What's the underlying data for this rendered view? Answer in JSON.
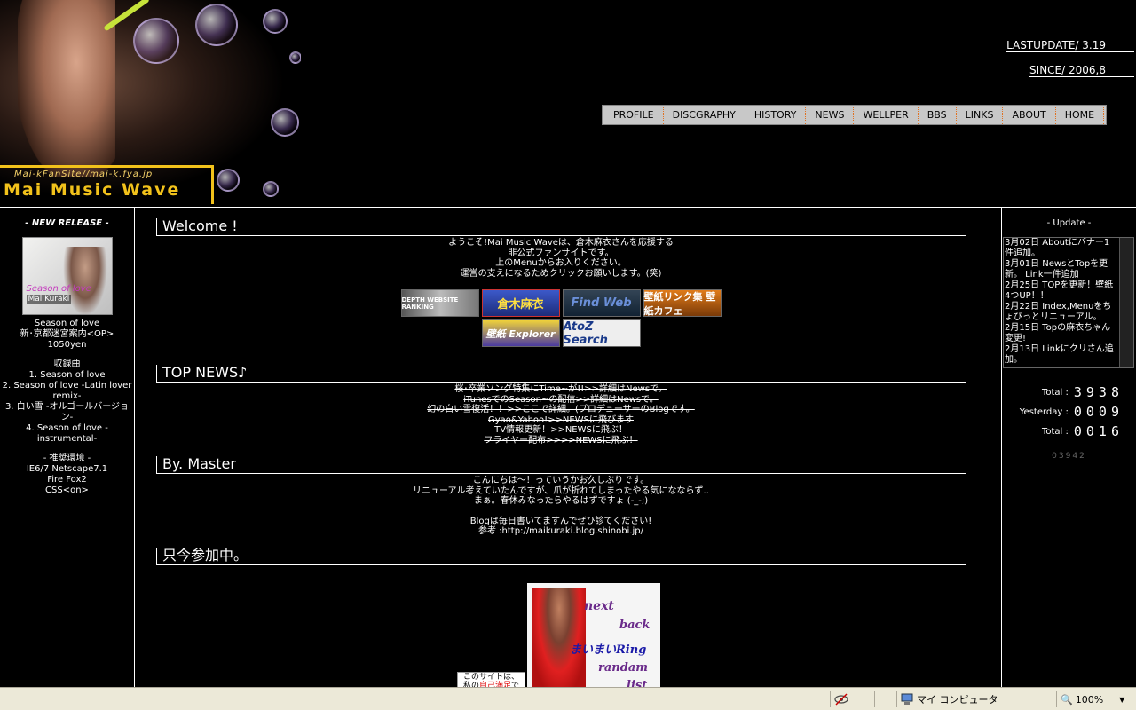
{
  "header": {
    "logo_sub": "Mai-kFanSite//mai-k.fya.jp",
    "logo_title": "Mai Music Wave",
    "lastupdate": "LASTUPDATE/ 3.19",
    "since": "SINCE/ 2006,8"
  },
  "nav": [
    "PROFILE",
    "DISCGRAPHY",
    "HISTORY",
    "NEWS",
    "WELLPER",
    "BBS",
    "LINKS",
    "ABOUT",
    "HOME"
  ],
  "left": {
    "release_head": "- NEW RELEASE -",
    "cover_title": "Season of love",
    "cover_artist": "Mai Kuraki",
    "release_title": "Season of love",
    "release_sub": "新･京都迷宮案内<OP>",
    "price": "1050yen",
    "tracks_head": "収録曲",
    "tracks": [
      "1. Season of love",
      "2. Season of love -Latin lover",
      "remix-",
      "3. 白い雪 -オルゴールバージョン-",
      "4. Season of love -",
      "instrumental-"
    ],
    "env_head": "- 推奨環境 -",
    "env": [
      "IE6/7 Netscape7.1",
      "Fire Fox2",
      "CSS<on>"
    ]
  },
  "main": {
    "welcome_title": "Welcome !",
    "welcome_lines": [
      "ようこそ!Mai Music Waveは、倉木麻衣さんを応援する",
      "非公式ファンサイトです。",
      "上のMenuからお入りください。",
      "運営の支えになるためクリックお願いします。(笑)"
    ],
    "banners": {
      "depth": "DEPTH WEBSITE RANKING",
      "kuraki": "倉木麻衣",
      "findweb": "Find Web",
      "wallcafe": "壁紙リンク集 壁紙カフェ",
      "wallexp": "壁紙 Explorer",
      "atoz": "AtoZ Search"
    },
    "news_title": "TOP NEWS♪",
    "news_lines": [
      "桜･卒業ソング特集にTime~が!!>>詳細はNewsで。",
      "iTunesでのSeason~の配信>>詳細はNewsで。",
      "幻の白い雪復活！！>>ここで詳細。(プロデューサーのBlogです。",
      "Gyao&Yahoo!>>NEWSに飛びます",
      "TV情報更新！>>NEWSに飛ぶ！",
      "フライヤー配布>>>>NEWSに飛ぶ！"
    ],
    "master_title": "By. Master",
    "master_lines": [
      "こんにちは～！っていうかお久しぶりです。",
      "リニューアル考えていたんですが、爪が折れてしまったやる気になならず‥",
      "まぁ。春休みなったらやるはずですょ (-_-;)",
      "",
      "Blogは毎日書いてますんでぜひ診てください!",
      "参考 :http://maikuraki.blog.shinobi.jp/"
    ],
    "join_title": "只今参加中。",
    "ring": {
      "next": "next",
      "back": "back",
      "name": "まいまいRing",
      "random": "randam",
      "list": "list"
    },
    "stamp_line1": "このサイトは、",
    "stamp_line2a": "私の",
    "stamp_line2b": "自己満足",
    "stamp_line2c": "で"
  },
  "right": {
    "update_head": "- Update -",
    "updates": [
      "3月02日 Aboutにバナー1件追加。",
      "3月01日 NewsとTopを更新。 Link一件追加",
      "2月25日 TOPを更新！壁紙4つUP！！",
      "2月22日 Index,Menuをちょびっとリニューアル。",
      "2月15日 Topの麻衣ちゃん変更!",
      "2月13日 Linkにクリさん追加。"
    ],
    "counter": [
      {
        "label": "Total :",
        "value": "3938"
      },
      {
        "label": "Yesterday :",
        "value": "0009"
      },
      {
        "label": "Total :",
        "value": "0016"
      }
    ],
    "small_counter": "03942"
  },
  "statusbar": {
    "zone": "マイ コンピュータ",
    "zoom": "100%"
  }
}
